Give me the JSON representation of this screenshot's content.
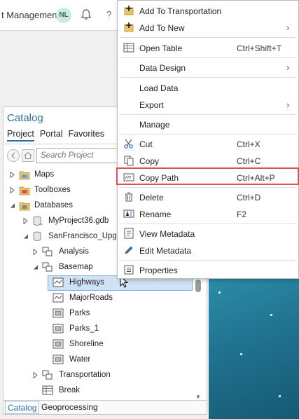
{
  "topbar": {
    "title": "t Management",
    "avatar_initials": "NL",
    "help_glyph": "?"
  },
  "catalog": {
    "title": "Catalog",
    "tabs": [
      "Project",
      "Portal",
      "Favorites"
    ],
    "active_tab": "Project",
    "search_placeholder": "Search Project",
    "tree": [
      {
        "label": "Maps",
        "icon": "maps-folder-icon"
      },
      {
        "label": "Toolboxes",
        "icon": "toolbox-folder-icon"
      },
      {
        "label": "Databases",
        "icon": "database-folder-icon"
      },
      {
        "label": "MyProject36.gdb",
        "icon": "geodatabase-icon"
      },
      {
        "label": "SanFrancisco_Upgrac",
        "icon": "geodatabase-icon"
      },
      {
        "label": "Analysis",
        "icon": "feature-dataset-icon"
      },
      {
        "label": "Basemap",
        "icon": "feature-dataset-icon"
      },
      {
        "label": "Highways",
        "icon": "line-feature-class-icon"
      },
      {
        "label": "MajorRoads",
        "icon": "line-feature-class-icon"
      },
      {
        "label": "Parks",
        "icon": "polygon-feature-class-icon"
      },
      {
        "label": "Parks_1",
        "icon": "polygon-feature-class-icon"
      },
      {
        "label": "Shoreline",
        "icon": "polygon-feature-class-icon"
      },
      {
        "label": "Water",
        "icon": "polygon-feature-class-icon"
      },
      {
        "label": "Transportation",
        "icon": "feature-dataset-icon"
      },
      {
        "label": "Break",
        "icon": "table-icon"
      }
    ],
    "bottom_tabs": [
      "Catalog",
      "Geoprocessing"
    ]
  },
  "menu": {
    "items": [
      {
        "label": "Add To Transportation",
        "shortcut": "",
        "submenu": false,
        "icon": "add-to-dataset-icon"
      },
      {
        "label": "Add To New",
        "shortcut": "",
        "submenu": true,
        "icon": "add-new-icon"
      },
      {
        "label": "Open Table",
        "shortcut": "Ctrl+Shift+T",
        "submenu": false,
        "icon": "table-icon"
      },
      {
        "label": "Data Design",
        "shortcut": "",
        "submenu": true,
        "icon": ""
      },
      {
        "label": "Load Data",
        "shortcut": "",
        "submenu": false,
        "icon": ""
      },
      {
        "label": "Export",
        "shortcut": "",
        "submenu": true,
        "icon": ""
      },
      {
        "label": "Manage",
        "shortcut": "",
        "submenu": false,
        "icon": ""
      },
      {
        "label": "Cut",
        "shortcut": "Ctrl+X",
        "submenu": false,
        "icon": "scissors-icon"
      },
      {
        "label": "Copy",
        "shortcut": "Ctrl+C",
        "submenu": false,
        "icon": "copy-icon"
      },
      {
        "label": "Copy Path",
        "shortcut": "Ctrl+Alt+P",
        "submenu": false,
        "icon": "copy-path-icon"
      },
      {
        "label": "Delete",
        "shortcut": "Ctrl+D",
        "submenu": false,
        "icon": "delete-icon"
      },
      {
        "label": "Rename",
        "shortcut": "F2",
        "submenu": false,
        "icon": "rename-icon"
      },
      {
        "label": "View Metadata",
        "shortcut": "",
        "submenu": false,
        "icon": "view-metadata-icon"
      },
      {
        "label": "Edit Metadata",
        "shortcut": "",
        "submenu": false,
        "icon": "pencil-icon"
      },
      {
        "label": "Properties",
        "shortcut": "",
        "submenu": false,
        "icon": "properties-icon"
      }
    ],
    "submenu_glyph": "›"
  },
  "colors": {
    "accent": "#2e6fa7",
    "selection": "#cfe3f5",
    "highlight_box": "#e15050",
    "map_water": "#1e7792"
  }
}
